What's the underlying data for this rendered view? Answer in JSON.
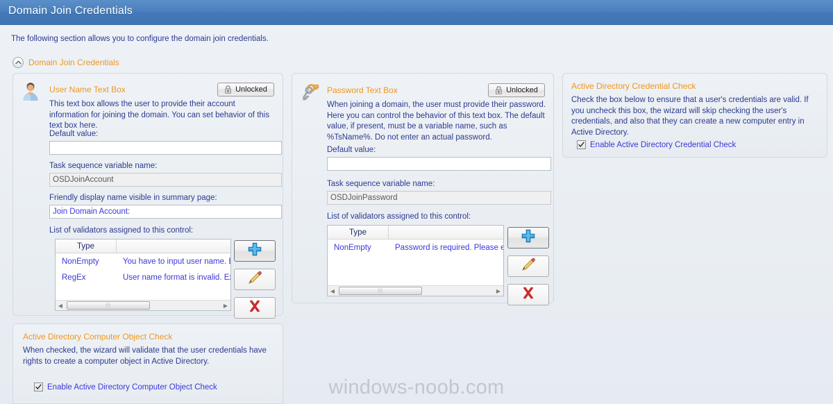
{
  "window": {
    "title": "Domain Join Credentials"
  },
  "intro": {
    "text": "The following section allows you to configure the domain join credentials."
  },
  "group": {
    "title": "Domain Join Credentials",
    "expander_icon": "chevron-up-icon"
  },
  "colors": {
    "titlebar": "#4a7fbd",
    "accent_orange": "#f0961e",
    "link_blue": "#3a38d8",
    "label_navy": "#2b3a8f",
    "panel_bg": "#eef2f6",
    "panel_border": "#d2d9e0"
  },
  "panels": {
    "username": {
      "icon": "user-icon",
      "title": "User Name Text Box",
      "description": "This text box allows the user to provide their account information for joining the domain. You can set behavior of this text box here.",
      "lock_button": {
        "label": "Unlocked",
        "icon": "lock-icon"
      },
      "default_value_label": "Default value:",
      "default_value": "",
      "default_value_placeholder": "",
      "ts_variable_label": "Task sequence variable name:",
      "ts_variable_value": "OSDJoinAccount",
      "friendly_name_label": "Friendly display name visible in summary page:",
      "friendly_name_value": "Join Domain Account:",
      "validators_label": "List of validators assigned to this control:",
      "validators_columns": [
        "Type",
        ""
      ],
      "validators_rows": [
        {
          "type": "NonEmpty",
          "message": "You have to input user name. Exa"
        },
        {
          "type": "RegEx",
          "message": "User name format is invalid. Exam"
        }
      ],
      "actions": [
        {
          "name": "add-validator-button",
          "icon": "plus-icon"
        },
        {
          "name": "edit-validator-button",
          "icon": "pencil-icon"
        },
        {
          "name": "delete-validator-button",
          "icon": "red-x-icon"
        }
      ]
    },
    "password": {
      "icon": "keys-icon",
      "title": "Password Text Box",
      "description": "When joining a domain, the user must provide their password. Here you can control the behavior of this text box. The default value, if present, must be a variable name, such as %TsName%. Do not enter an actual password.",
      "lock_button": {
        "label": "Unlocked",
        "icon": "lock-icon"
      },
      "default_value_label": "Default value:",
      "default_value": "",
      "default_value_placeholder": "",
      "ts_variable_label": "Task sequence variable name:",
      "ts_variable_value": "OSDJoinPassword",
      "validators_label": "List of validators assigned to this control:",
      "validators_columns": [
        "Type",
        ""
      ],
      "validators_rows": [
        {
          "type": "NonEmpty",
          "message": "Password is required. Please ente"
        }
      ],
      "actions": [
        {
          "name": "add-validator-button",
          "icon": "plus-icon"
        },
        {
          "name": "edit-validator-button",
          "icon": "pencil-icon"
        },
        {
          "name": "delete-validator-button",
          "icon": "red-x-icon"
        }
      ]
    },
    "credential_check": {
      "title": "Active Directory Credential Check",
      "description": "Check the box below to ensure that a user's credentials are valid. If you uncheck this box, the wizard will skip checking the user's credentials, and also that they can create a new computer entry in Active Directory.",
      "checkbox_label": "Enable Active Directory Credential Check",
      "checkbox_checked": true
    },
    "object_check": {
      "title": "Active Directory Computer Object Check",
      "description": "When checked, the wizard will validate that the user credentials have rights to create a computer object in Active Directory.",
      "checkbox_label": "Enable Active Directory Computer Object Check",
      "checkbox_checked": true
    }
  },
  "watermark": {
    "text": "windows-noob.com"
  }
}
